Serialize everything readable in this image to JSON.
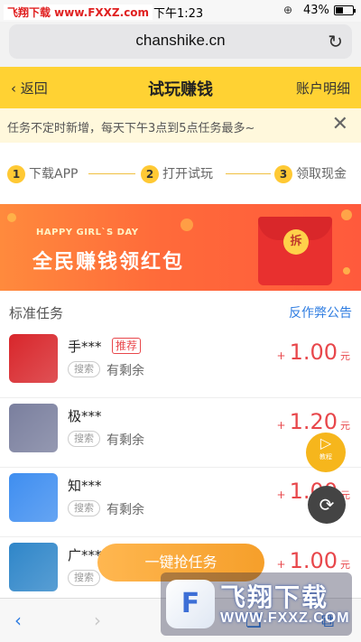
{
  "status_bar": {
    "watermark_text": "飞翔下载 www.FXXZ.com",
    "time": "下午1:23",
    "battery_text": "43%",
    "battery_level": 0.43
  },
  "browser": {
    "url": "chanshike.cn"
  },
  "nav": {
    "back_label": "返回",
    "title": "试玩赚钱",
    "account_label": "账户明细"
  },
  "notice": {
    "text": "任务不定时新增，每天下午3点到5点任务最多~",
    "close_glyph": "✕"
  },
  "steps": [
    {
      "num": "1",
      "label": "下载APP"
    },
    {
      "num": "2",
      "label": "打开试玩"
    },
    {
      "num": "3",
      "label": "领取现金"
    }
  ],
  "banner": {
    "subtitle": "HAPPY GIRL`S DAY",
    "title": "全民赚钱领红包",
    "seal_text": "拆"
  },
  "section": {
    "title": "标准任务",
    "link": "反作弊公告"
  },
  "tasks": [
    {
      "name": "手***",
      "tag": "推荐",
      "search_label": "搜索",
      "remain": "有剩余",
      "plus": "+",
      "amount": "1.00",
      "unit": "元",
      "thumb_color": "#d8262b"
    },
    {
      "name": "极***",
      "tag": "",
      "search_label": "搜索",
      "remain": "有剩余",
      "plus": "+",
      "amount": "1.20",
      "unit": "元",
      "thumb_color": "#7a7f9e"
    },
    {
      "name": "知***",
      "tag": "",
      "search_label": "搜索",
      "remain": "有剩余",
      "plus": "+",
      "amount": "1.00",
      "unit": "元",
      "thumb_color": "#3f8ef0"
    },
    {
      "name": "广***",
      "tag": "",
      "search_label": "搜索",
      "remain": "",
      "plus": "+",
      "amount": "1.00",
      "unit": "元",
      "thumb_color": "#2f86c9"
    }
  ],
  "fab": {
    "tutorial_label": "教程",
    "tutorial_icon": "play-icon"
  },
  "grab_button": "一键抢任务",
  "overlay_watermark": {
    "logo_glyph": "F",
    "brand": "飞翔下载",
    "site": "WWW.FXXZ.COM"
  },
  "colors": {
    "nav_yellow": "#ffd233",
    "price_red": "#e8474b",
    "link_blue": "#2f7de1",
    "banner_orange": "#ff6a3a"
  }
}
